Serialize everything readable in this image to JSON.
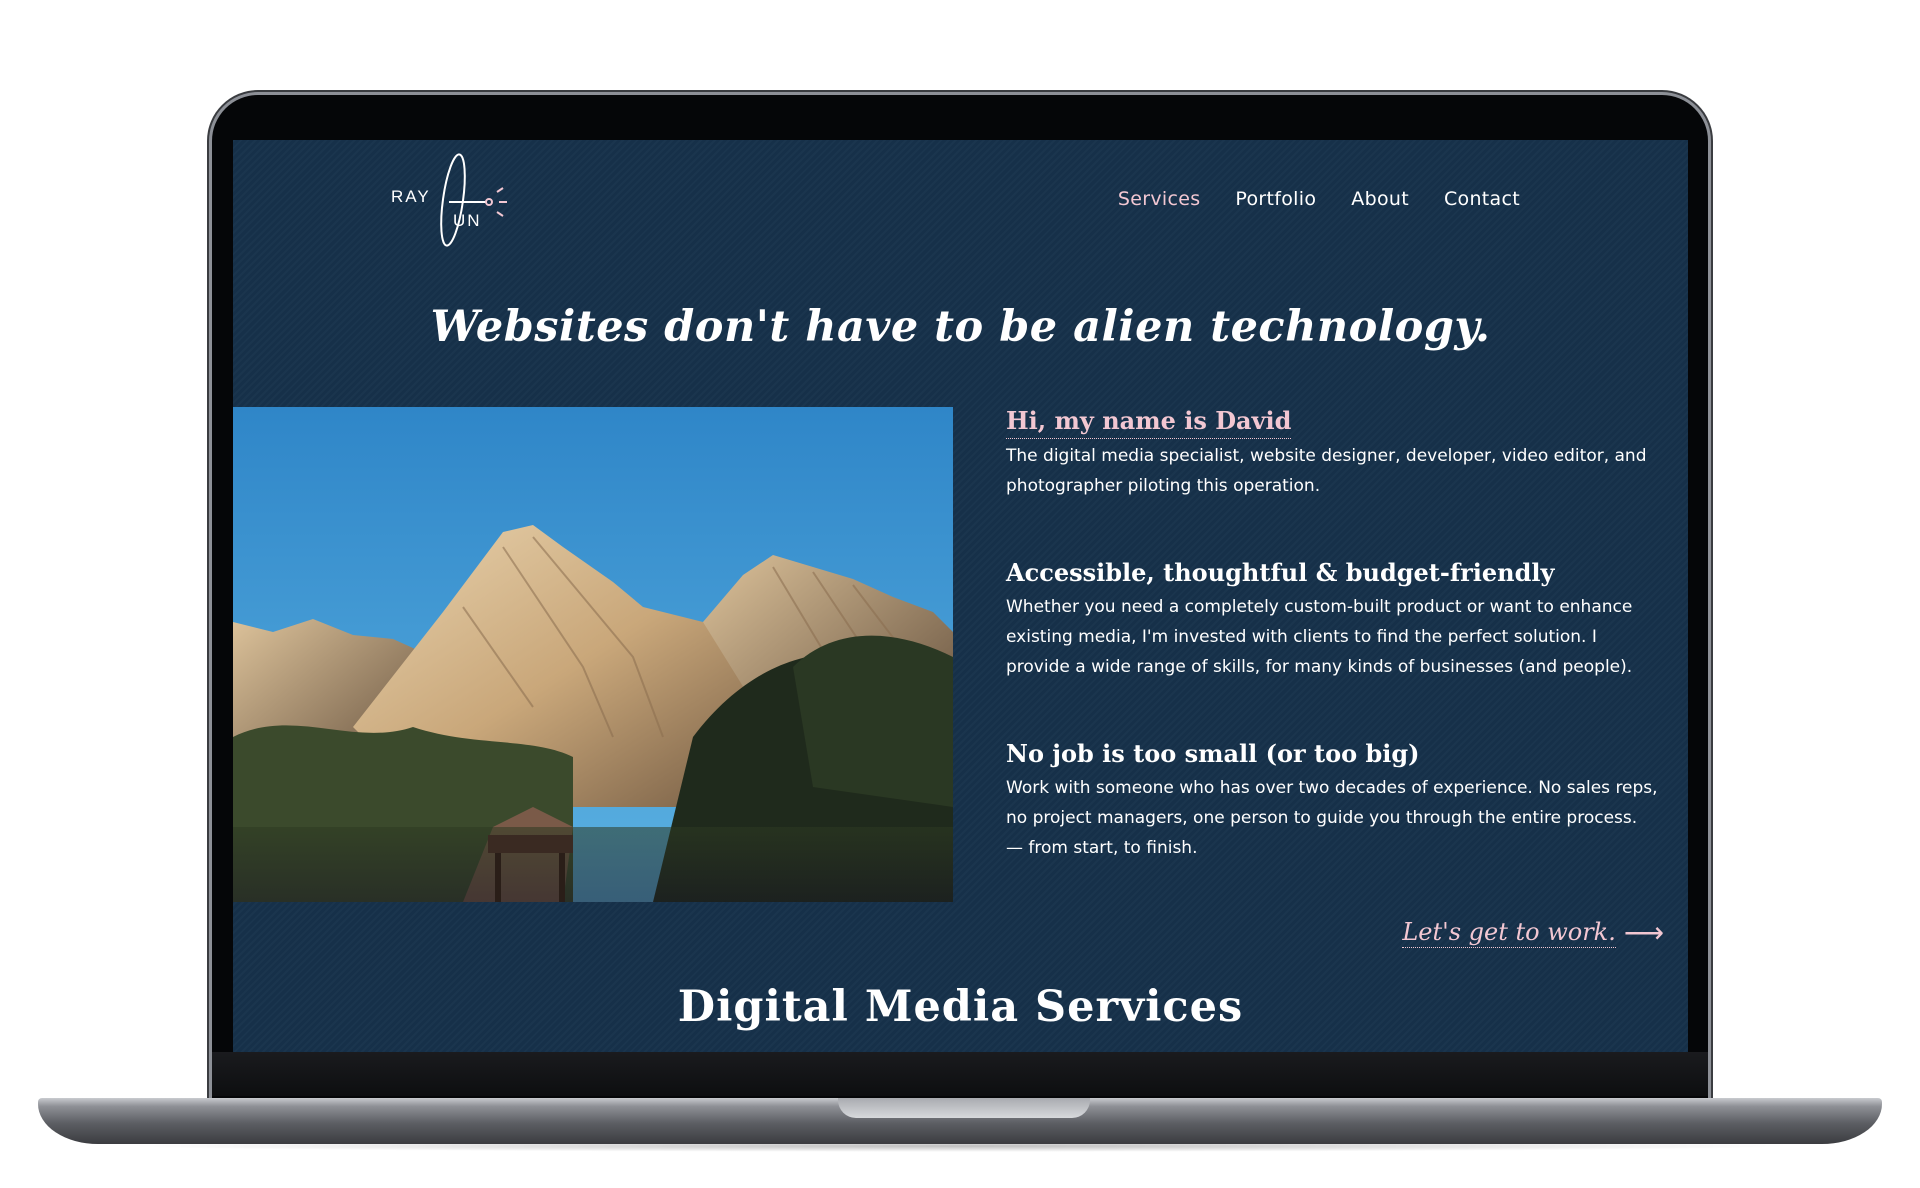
{
  "brand": {
    "logo_top": "RAY",
    "logo_bottom": "UN",
    "accent_color": "#f2c7d2",
    "background_color": "#16314a"
  },
  "nav": {
    "items": [
      {
        "label": "Services",
        "active": true
      },
      {
        "label": "Portfolio",
        "active": false
      },
      {
        "label": "About",
        "active": false
      },
      {
        "label": "Contact",
        "active": false
      }
    ]
  },
  "hero": {
    "headline": "Websites don't have to be alien technology."
  },
  "intro_blocks": [
    {
      "title": "Hi, my name is David",
      "text": "The digital media specialist, website designer, developer, video editor, and photographer piloting this operation."
    },
    {
      "title": "Accessible, thoughtful & budget-friendly",
      "text": "Whether you need a completely custom-built product or want to enhance existing media, I'm invested with clients to find the perfect solution. I provide a wide range of skills, for many kinds of businesses (and people)."
    },
    {
      "title": "No job is too small (or too big)",
      "text": "Work with someone who has over two decades of experience. No sales reps, no project managers, one person to guide you through the entire process.",
      "text_extra": "— from start, to finish."
    }
  ],
  "cta": {
    "label": "Let's get to work.",
    "icon": "arrow-right-icon"
  },
  "section": {
    "title": "Digital Media Services"
  }
}
